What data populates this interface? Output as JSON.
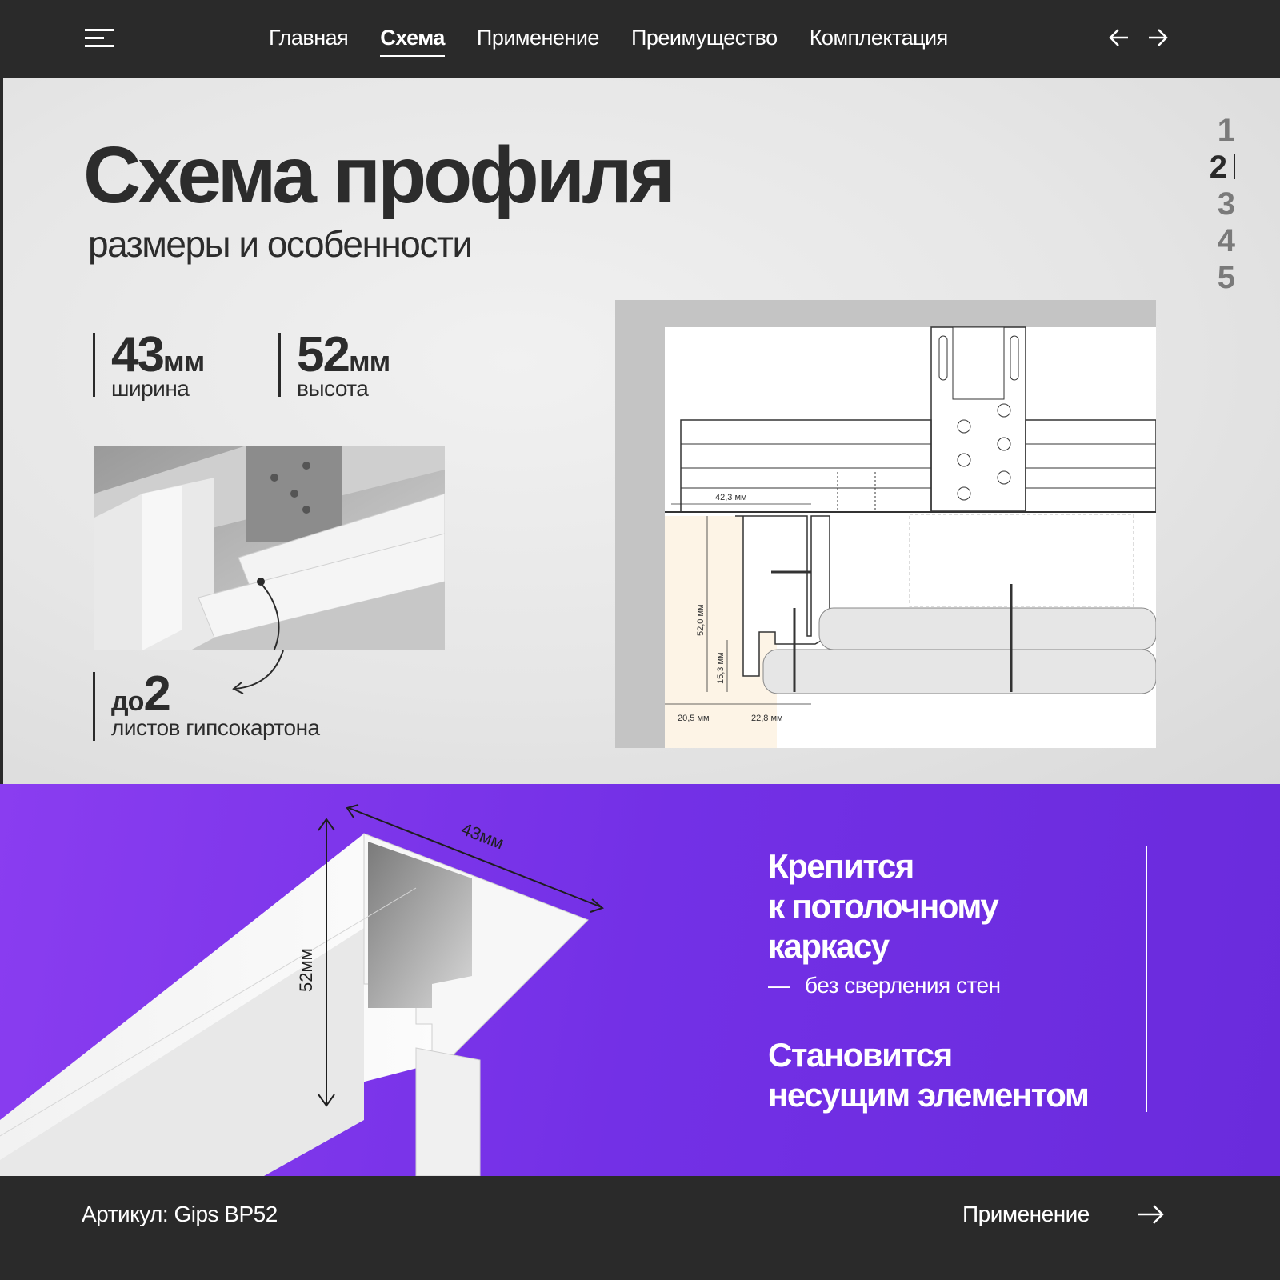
{
  "nav": {
    "items": [
      "Главная",
      "Схема",
      "Применение",
      "Преимущество",
      "Комплектация"
    ],
    "active_index": 1
  },
  "hero": {
    "title": "Схема профиля",
    "subtitle": "размеры и особенности",
    "pager": [
      "1",
      "2",
      "3",
      "4",
      "5"
    ],
    "pager_active": "2",
    "stats": {
      "width": {
        "value": "43",
        "unit": "мм",
        "label": "ширина"
      },
      "height": {
        "value": "52",
        "unit": "мм",
        "label": "высота"
      },
      "sheets": {
        "prefix": "до",
        "value": "2",
        "label": "листов гипсокартона"
      }
    },
    "drawing_dims": {
      "top": "42,3 мм",
      "vertical_total": "52,0 мм",
      "vertical_lower": "15,3 мм",
      "bottom_left": "20,5 мм",
      "bottom_right": "22,8 мм"
    }
  },
  "promo": {
    "dim_width": "43мм",
    "dim_height": "52мм",
    "feature1_lines": [
      "Крепится",
      "к потолочному",
      "каркасу"
    ],
    "feature1_dash": "—",
    "feature1_sub": "без сверления стен",
    "feature2_lines": [
      "Становится",
      "несущим элементом"
    ]
  },
  "footer": {
    "sku": "Артикул: Gips BP52",
    "next_label": "Применение"
  },
  "colors": {
    "dark": "#2a2a2a",
    "purple": "#7330e6",
    "text": "#2c2c2c"
  }
}
